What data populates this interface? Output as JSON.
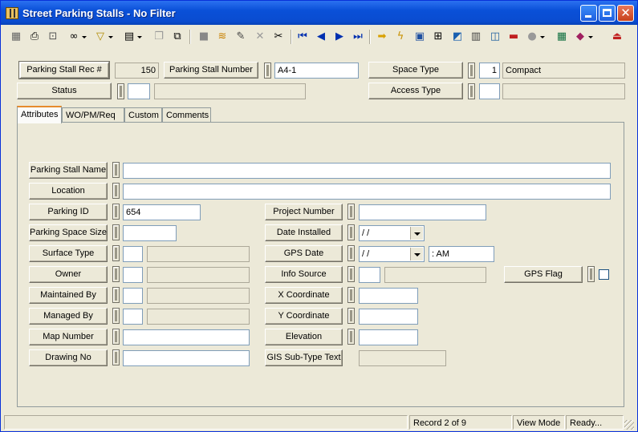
{
  "window": {
    "title": "Street Parking Stalls - No Filter"
  },
  "toolbar": {
    "icons": [
      "layout-icon",
      "print-icon",
      "print-preview-icon",
      "binoculars-icon",
      "filter-icon",
      "new-record-icon",
      "copy-record-icon",
      "paste-record-icon",
      "disk-icon",
      "stack-icon",
      "edit-pencil-icon",
      "delete-x-icon",
      "scissors-icon",
      "first-record-icon",
      "previous-record-icon",
      "next-record-icon",
      "last-record-icon",
      "arrow-right-icon",
      "lightning-icon",
      "map-icon",
      "hierarchy-icon",
      "gis-icon",
      "calendar-icon",
      "report-icon",
      "work-order-icon",
      "globe-icon",
      "calculator-icon",
      "books-icon",
      "exit-icon"
    ]
  },
  "header": {
    "rec_label": "Parking Stall Rec #",
    "rec_value": "150",
    "number_label": "Parking Stall Number",
    "number_value": "A4-1",
    "space_type_label": "Space Type",
    "space_type_code": "1",
    "space_type_desc": "Compact",
    "status_label": "Status",
    "status_code": "",
    "status_desc": "",
    "access_type_label": "Access Type",
    "access_type_code": "",
    "access_type_desc": ""
  },
  "tabs": [
    "Attributes",
    "WO/PM/Req",
    "Custom",
    "Comments"
  ],
  "attributes": {
    "stall_name_label": "Parking Stall Name",
    "stall_name_value": "",
    "location_label": "Location",
    "location_value": "",
    "parking_id_label": "Parking ID",
    "parking_id_value": "654",
    "space_size_label": "Parking Space Size",
    "space_size_value": "",
    "surface_type_label": "Surface Type",
    "owner_label": "Owner",
    "maintained_by_label": "Maintained By",
    "managed_by_label": "Managed By",
    "map_number_label": "Map Number",
    "map_number_value": "",
    "drawing_no_label": "Drawing No",
    "drawing_no_value": "",
    "project_number_label": "Project Number",
    "project_number_value": "",
    "date_installed_label": "Date Installed",
    "date_installed_value": " /  /",
    "gps_date_label": "GPS Date",
    "gps_date_value": " /  /",
    "gps_time_value": " :  AM",
    "info_source_label": "Info Source",
    "x_coord_label": "X Coordinate",
    "x_coord_value": "",
    "y_coord_label": "Y Coordinate",
    "y_coord_value": "",
    "elevation_label": "Elevation",
    "elevation_value": "",
    "gis_subtype_label": "GIS Sub-Type Text",
    "gis_subtype_value": "",
    "gps_flag_label": "GPS Flag"
  },
  "statusbar": {
    "record": "Record 2 of 9",
    "mode": "View Mode",
    "state": "Ready..."
  }
}
